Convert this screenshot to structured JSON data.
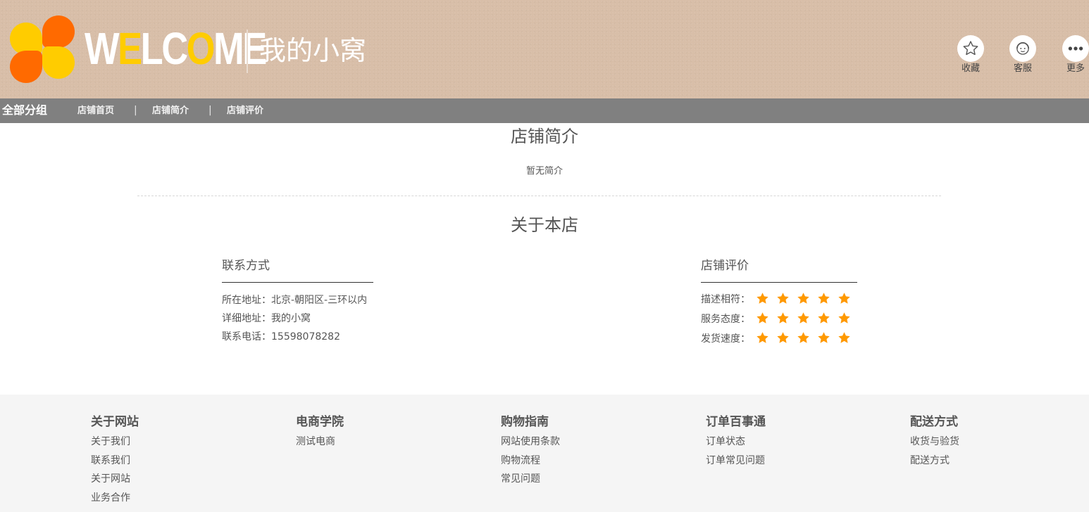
{
  "header": {
    "welcome_part1": "W",
    "welcome_hl1": "E",
    "welcome_part2": "LC",
    "welcome_hl2": "O",
    "welcome_part3": "ME",
    "shop_name": "我的小窝",
    "actions": [
      {
        "label": "收藏",
        "icon": "star-outline-icon"
      },
      {
        "label": "客服",
        "icon": "customer-service-icon"
      },
      {
        "label": "更多",
        "icon": "more-icon"
      }
    ]
  },
  "nav": {
    "all_groups": "全部分组",
    "links": [
      "店铺首页",
      "店铺简介",
      "店铺评价"
    ],
    "separator": "|"
  },
  "intro": {
    "title": "店铺简介",
    "text": "暂无简介"
  },
  "about": {
    "title": "关于本店",
    "contact": {
      "title": "联系方式",
      "lines": [
        "所在地址：北京-朝阳区-三环以内",
        "详细地址：我的小窝",
        "联系电话：15598078282"
      ]
    },
    "rating": {
      "title": "店铺评价",
      "items": [
        {
          "label": "描述相符：",
          "stars": 5
        },
        {
          "label": "服务态度：",
          "stars": 5
        },
        {
          "label": "发货速度：",
          "stars": 5
        }
      ],
      "star_color": "#ff9900"
    }
  },
  "footer": {
    "columns": [
      {
        "title": "关于网站",
        "links": [
          "关于我们",
          "联系我们",
          "关于网站",
          "业务合作"
        ]
      },
      {
        "title": "电商学院",
        "links": [
          "测试电商"
        ]
      },
      {
        "title": "购物指南",
        "links": [
          "网站使用条款",
          "购物流程",
          "常见问题"
        ]
      },
      {
        "title": "订单百事通",
        "links": [
          "订单状态",
          "订单常见问题"
        ]
      },
      {
        "title": "配送方式",
        "links": [
          "收货与验货",
          "配送方式"
        ]
      }
    ]
  }
}
